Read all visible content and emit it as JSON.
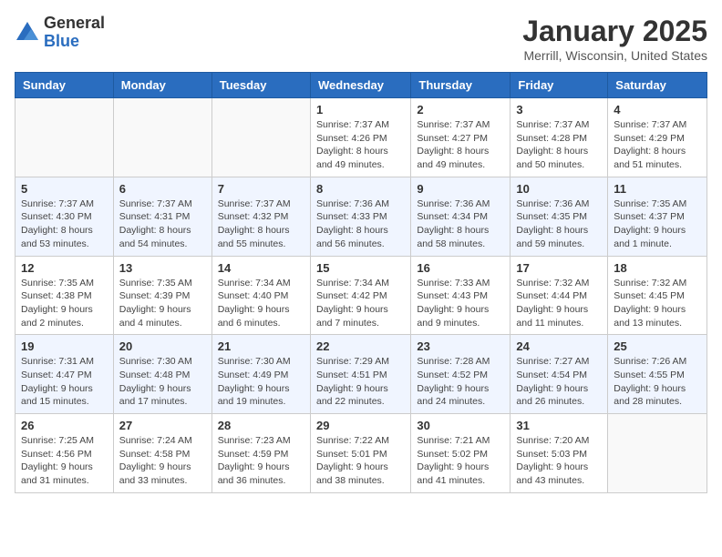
{
  "header": {
    "logo_general": "General",
    "logo_blue": "Blue",
    "title": "January 2025",
    "location": "Merrill, Wisconsin, United States"
  },
  "days_of_week": [
    "Sunday",
    "Monday",
    "Tuesday",
    "Wednesday",
    "Thursday",
    "Friday",
    "Saturday"
  ],
  "weeks": [
    [
      {
        "day": "",
        "info": ""
      },
      {
        "day": "",
        "info": ""
      },
      {
        "day": "",
        "info": ""
      },
      {
        "day": "1",
        "info": "Sunrise: 7:37 AM\nSunset: 4:26 PM\nDaylight: 8 hours\nand 49 minutes."
      },
      {
        "day": "2",
        "info": "Sunrise: 7:37 AM\nSunset: 4:27 PM\nDaylight: 8 hours\nand 49 minutes."
      },
      {
        "day": "3",
        "info": "Sunrise: 7:37 AM\nSunset: 4:28 PM\nDaylight: 8 hours\nand 50 minutes."
      },
      {
        "day": "4",
        "info": "Sunrise: 7:37 AM\nSunset: 4:29 PM\nDaylight: 8 hours\nand 51 minutes."
      }
    ],
    [
      {
        "day": "5",
        "info": "Sunrise: 7:37 AM\nSunset: 4:30 PM\nDaylight: 8 hours\nand 53 minutes."
      },
      {
        "day": "6",
        "info": "Sunrise: 7:37 AM\nSunset: 4:31 PM\nDaylight: 8 hours\nand 54 minutes."
      },
      {
        "day": "7",
        "info": "Sunrise: 7:37 AM\nSunset: 4:32 PM\nDaylight: 8 hours\nand 55 minutes."
      },
      {
        "day": "8",
        "info": "Sunrise: 7:36 AM\nSunset: 4:33 PM\nDaylight: 8 hours\nand 56 minutes."
      },
      {
        "day": "9",
        "info": "Sunrise: 7:36 AM\nSunset: 4:34 PM\nDaylight: 8 hours\nand 58 minutes."
      },
      {
        "day": "10",
        "info": "Sunrise: 7:36 AM\nSunset: 4:35 PM\nDaylight: 8 hours\nand 59 minutes."
      },
      {
        "day": "11",
        "info": "Sunrise: 7:35 AM\nSunset: 4:37 PM\nDaylight: 9 hours\nand 1 minute."
      }
    ],
    [
      {
        "day": "12",
        "info": "Sunrise: 7:35 AM\nSunset: 4:38 PM\nDaylight: 9 hours\nand 2 minutes."
      },
      {
        "day": "13",
        "info": "Sunrise: 7:35 AM\nSunset: 4:39 PM\nDaylight: 9 hours\nand 4 minutes."
      },
      {
        "day": "14",
        "info": "Sunrise: 7:34 AM\nSunset: 4:40 PM\nDaylight: 9 hours\nand 6 minutes."
      },
      {
        "day": "15",
        "info": "Sunrise: 7:34 AM\nSunset: 4:42 PM\nDaylight: 9 hours\nand 7 minutes."
      },
      {
        "day": "16",
        "info": "Sunrise: 7:33 AM\nSunset: 4:43 PM\nDaylight: 9 hours\nand 9 minutes."
      },
      {
        "day": "17",
        "info": "Sunrise: 7:32 AM\nSunset: 4:44 PM\nDaylight: 9 hours\nand 11 minutes."
      },
      {
        "day": "18",
        "info": "Sunrise: 7:32 AM\nSunset: 4:45 PM\nDaylight: 9 hours\nand 13 minutes."
      }
    ],
    [
      {
        "day": "19",
        "info": "Sunrise: 7:31 AM\nSunset: 4:47 PM\nDaylight: 9 hours\nand 15 minutes."
      },
      {
        "day": "20",
        "info": "Sunrise: 7:30 AM\nSunset: 4:48 PM\nDaylight: 9 hours\nand 17 minutes."
      },
      {
        "day": "21",
        "info": "Sunrise: 7:30 AM\nSunset: 4:49 PM\nDaylight: 9 hours\nand 19 minutes."
      },
      {
        "day": "22",
        "info": "Sunrise: 7:29 AM\nSunset: 4:51 PM\nDaylight: 9 hours\nand 22 minutes."
      },
      {
        "day": "23",
        "info": "Sunrise: 7:28 AM\nSunset: 4:52 PM\nDaylight: 9 hours\nand 24 minutes."
      },
      {
        "day": "24",
        "info": "Sunrise: 7:27 AM\nSunset: 4:54 PM\nDaylight: 9 hours\nand 26 minutes."
      },
      {
        "day": "25",
        "info": "Sunrise: 7:26 AM\nSunset: 4:55 PM\nDaylight: 9 hours\nand 28 minutes."
      }
    ],
    [
      {
        "day": "26",
        "info": "Sunrise: 7:25 AM\nSunset: 4:56 PM\nDaylight: 9 hours\nand 31 minutes."
      },
      {
        "day": "27",
        "info": "Sunrise: 7:24 AM\nSunset: 4:58 PM\nDaylight: 9 hours\nand 33 minutes."
      },
      {
        "day": "28",
        "info": "Sunrise: 7:23 AM\nSunset: 4:59 PM\nDaylight: 9 hours\nand 36 minutes."
      },
      {
        "day": "29",
        "info": "Sunrise: 7:22 AM\nSunset: 5:01 PM\nDaylight: 9 hours\nand 38 minutes."
      },
      {
        "day": "30",
        "info": "Sunrise: 7:21 AM\nSunset: 5:02 PM\nDaylight: 9 hours\nand 41 minutes."
      },
      {
        "day": "31",
        "info": "Sunrise: 7:20 AM\nSunset: 5:03 PM\nDaylight: 9 hours\nand 43 minutes."
      },
      {
        "day": "",
        "info": ""
      }
    ]
  ]
}
